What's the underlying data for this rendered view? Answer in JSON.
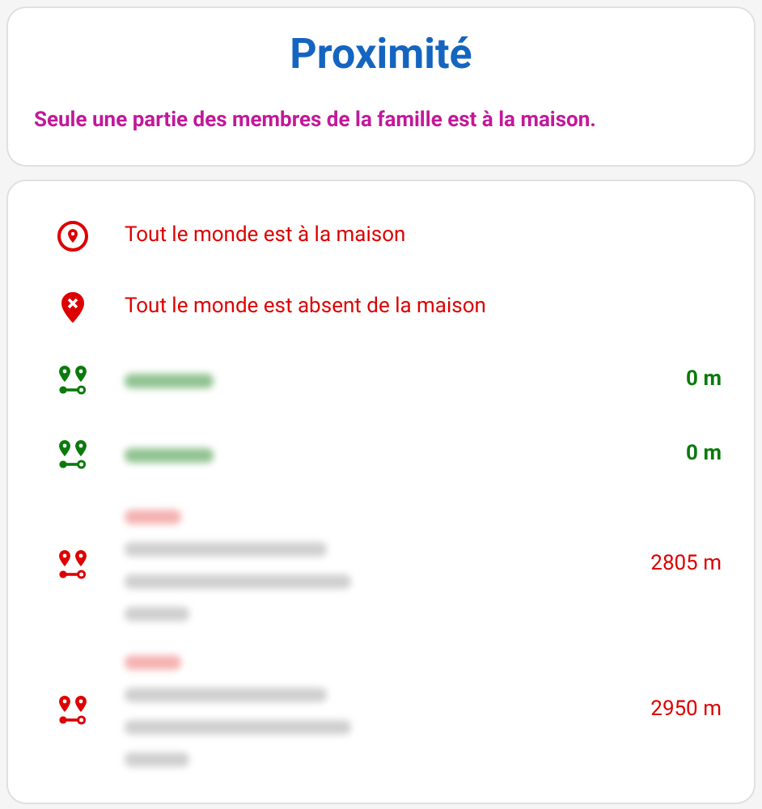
{
  "header": {
    "title": "Proximité",
    "message": "Seule une partie des membres de la famille est à la maison."
  },
  "rows": [
    {
      "kind": "all_home",
      "label": "Tout le monde est à la maison"
    },
    {
      "kind": "all_away",
      "label": "Tout le monde est absent de la maison"
    },
    {
      "kind": "member",
      "at_home": true,
      "name_redacted": true,
      "address_redacted": false,
      "distance": "0 m"
    },
    {
      "kind": "member",
      "at_home": true,
      "name_redacted": true,
      "address_redacted": false,
      "distance": "0 m"
    },
    {
      "kind": "member",
      "at_home": false,
      "name_redacted": true,
      "address_redacted": true,
      "distance": "2805 m"
    },
    {
      "kind": "member",
      "at_home": false,
      "name_redacted": true,
      "address_redacted": true,
      "distance": "2950 m"
    }
  ]
}
